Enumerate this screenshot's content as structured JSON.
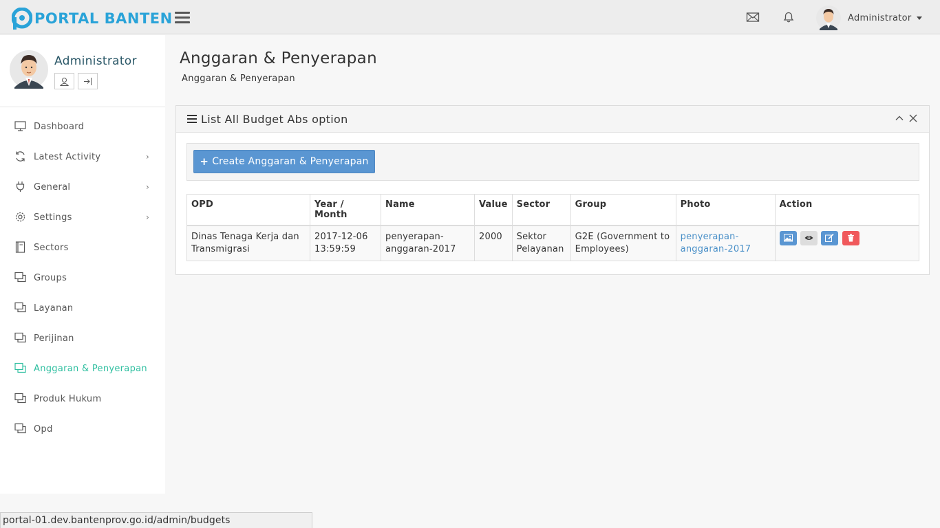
{
  "app": {
    "logo_text": "PORTAL BANTEN",
    "user_name": "Administrator"
  },
  "icons": {
    "menu": "hamburger-icon",
    "mail": "envelope-icon",
    "notifications": "bell-icon"
  },
  "sidebar": {
    "profile_name": "Administrator",
    "items": [
      {
        "label": "Dashboard",
        "icon": "monitor-icon",
        "has_submenu": false
      },
      {
        "label": "Latest Activity",
        "icon": "refresh-icon",
        "has_submenu": true
      },
      {
        "label": "General",
        "icon": "plug-icon",
        "has_submenu": true
      },
      {
        "label": "Settings",
        "icon": "gear-icon",
        "has_submenu": true
      },
      {
        "label": "Sectors",
        "icon": "book-icon",
        "has_submenu": false
      },
      {
        "label": "Groups",
        "icon": "windows-icon",
        "has_submenu": false
      },
      {
        "label": "Layanan",
        "icon": "windows-icon",
        "has_submenu": false
      },
      {
        "label": "Perijinan",
        "icon": "windows-icon",
        "has_submenu": false
      },
      {
        "label": "Anggaran & Penyerapan",
        "icon": "windows-icon",
        "has_submenu": false,
        "active": true
      },
      {
        "label": "Produk Hukum",
        "icon": "windows-icon",
        "has_submenu": false
      },
      {
        "label": "Opd",
        "icon": "windows-icon",
        "has_submenu": false
      }
    ]
  },
  "page": {
    "title": "Anggaran & Penyerapan",
    "breadcrumb": "Anggaran & Penyerapan"
  },
  "panel": {
    "title": "List All Budget Abs option",
    "create_button": "Create Anggaran & Penyerapan"
  },
  "table": {
    "columns": [
      "OPD",
      "Year / Month",
      "Name",
      "Value",
      "Sector",
      "Group",
      "Photo",
      "Action"
    ],
    "rows": [
      {
        "opd": "Dinas Tenaga Kerja dan Transmigrasi",
        "year_month": "2017-12-06 13:59:59",
        "name": "penyerapan-anggaran-2017",
        "value": "2000",
        "sector": "Sektor Pelayanan",
        "group": "G2E (Government to Employees)",
        "photo_alt": "penyerapan-anggaran-2017"
      }
    ]
  },
  "status_bar": {
    "url": "portal-01.dev.bantenprov.go.id/admin/budgets"
  },
  "colors": {
    "brand": "#2aa3d8",
    "active_menu": "#2fbfa0",
    "primary_button": "#5a96d2",
    "btn_image": "#5a96d2",
    "btn_view": "#dddddd",
    "btn_edit": "#5a96d2",
    "btn_delete": "#f0595c"
  }
}
